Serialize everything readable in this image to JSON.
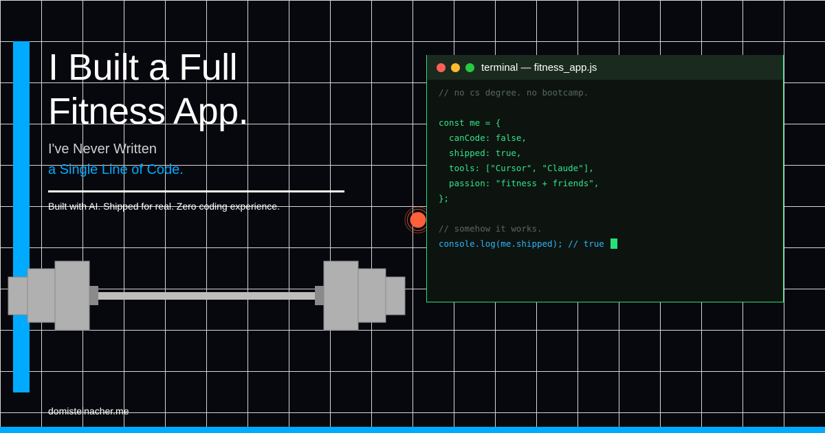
{
  "headline": {
    "line1": "I Built a Full",
    "line2": "Fitness App."
  },
  "subheadline": {
    "line1": "I've Never Written",
    "line2": "a Single Line of Code."
  },
  "tagline": "Built with AI. Shipped for real. Zero coding experience.",
  "site_url": "domisteinacher.me",
  "terminal": {
    "title": "terminal — fitness_app.js",
    "window_dots": [
      "#ff5f57",
      "#febc2e",
      "#28c840"
    ],
    "lines": [
      {
        "text": "// no cs degree. no bootcamp.",
        "style": "comment"
      },
      {
        "text": "",
        "style": "blank"
      },
      {
        "text": "const me = {",
        "style": "code"
      },
      {
        "text": "  canCode: false,",
        "style": "code"
      },
      {
        "text": "  shipped: true,",
        "style": "code"
      },
      {
        "text": "  tools: [\"Cursor\", \"Claude\"],",
        "style": "code"
      },
      {
        "text": "  passion: \"fitness + friends\",",
        "style": "code"
      },
      {
        "text": "};",
        "style": "code"
      },
      {
        "text": "",
        "style": "blank"
      },
      {
        "text": "// somehow it works.",
        "style": "comment"
      },
      {
        "text": "console.log(me.shipped); // true",
        "style": "output"
      }
    ]
  },
  "colors": {
    "accent": "#00aaff",
    "background": "#07080d",
    "terminal_green": "#27e07a",
    "pulse_dot": "#ff5f3a"
  },
  "icons": {
    "barbell": "barbell-icon",
    "status_dot": "pulse-dot-icon"
  }
}
